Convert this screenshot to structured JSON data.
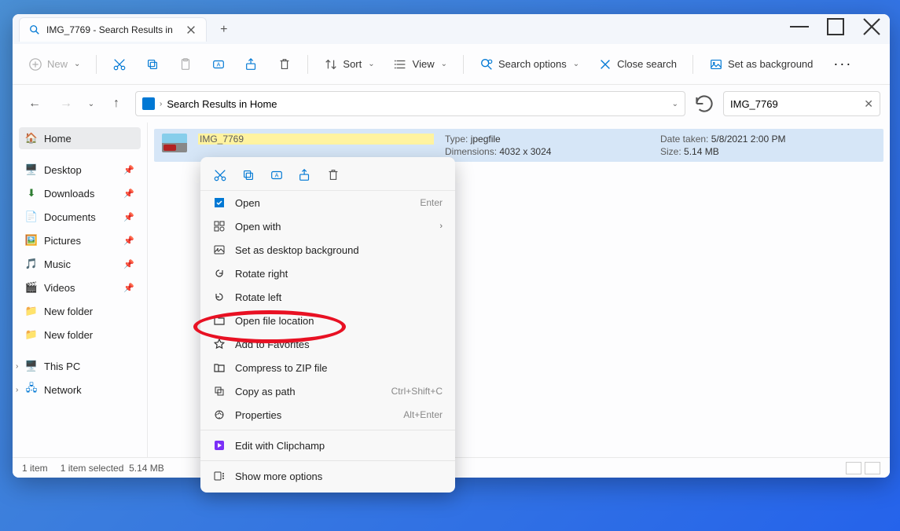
{
  "titlebar": {
    "tab_label": "IMG_7769 - Search Results in",
    "new_tab": "+"
  },
  "toolbar": {
    "new_label": "New",
    "sort_label": "Sort",
    "view_label": "View",
    "search_options_label": "Search options",
    "close_search_label": "Close search",
    "set_bg_label": "Set as background"
  },
  "addrbar": {
    "path_text": "Search Results in Home",
    "search_value": "IMG_7769"
  },
  "sidebar": {
    "home": "Home",
    "items": [
      {
        "label": "Desktop"
      },
      {
        "label": "Downloads"
      },
      {
        "label": "Documents"
      },
      {
        "label": "Pictures"
      },
      {
        "label": "Music"
      },
      {
        "label": "Videos"
      },
      {
        "label": "New folder"
      },
      {
        "label": "New folder"
      }
    ],
    "thispc": "This PC",
    "network": "Network"
  },
  "result": {
    "filename": "IMG_7769",
    "type_label": "Type:",
    "type_value": "jpegfile",
    "dim_label": "Dimensions:",
    "dim_value": "4032 x 3024",
    "date_label": "Date taken:",
    "date_value": "5/8/2021 2:00 PM",
    "size_label": "Size:",
    "size_value": "5.14 MB"
  },
  "ctx": {
    "open": "Open",
    "open_sc": "Enter",
    "open_with": "Open with",
    "set_bg": "Set as desktop background",
    "rotate_r": "Rotate right",
    "rotate_l": "Rotate left",
    "open_loc": "Open file location",
    "favorites": "Add to Favorites",
    "compress": "Compress to ZIP file",
    "copy_path": "Copy as path",
    "copy_path_sc": "Ctrl+Shift+C",
    "properties": "Properties",
    "properties_sc": "Alt+Enter",
    "clipchamp": "Edit with Clipchamp",
    "more": "Show more options"
  },
  "status": {
    "count": "1 item",
    "selected": "1 item selected",
    "size": "5.14 MB"
  }
}
